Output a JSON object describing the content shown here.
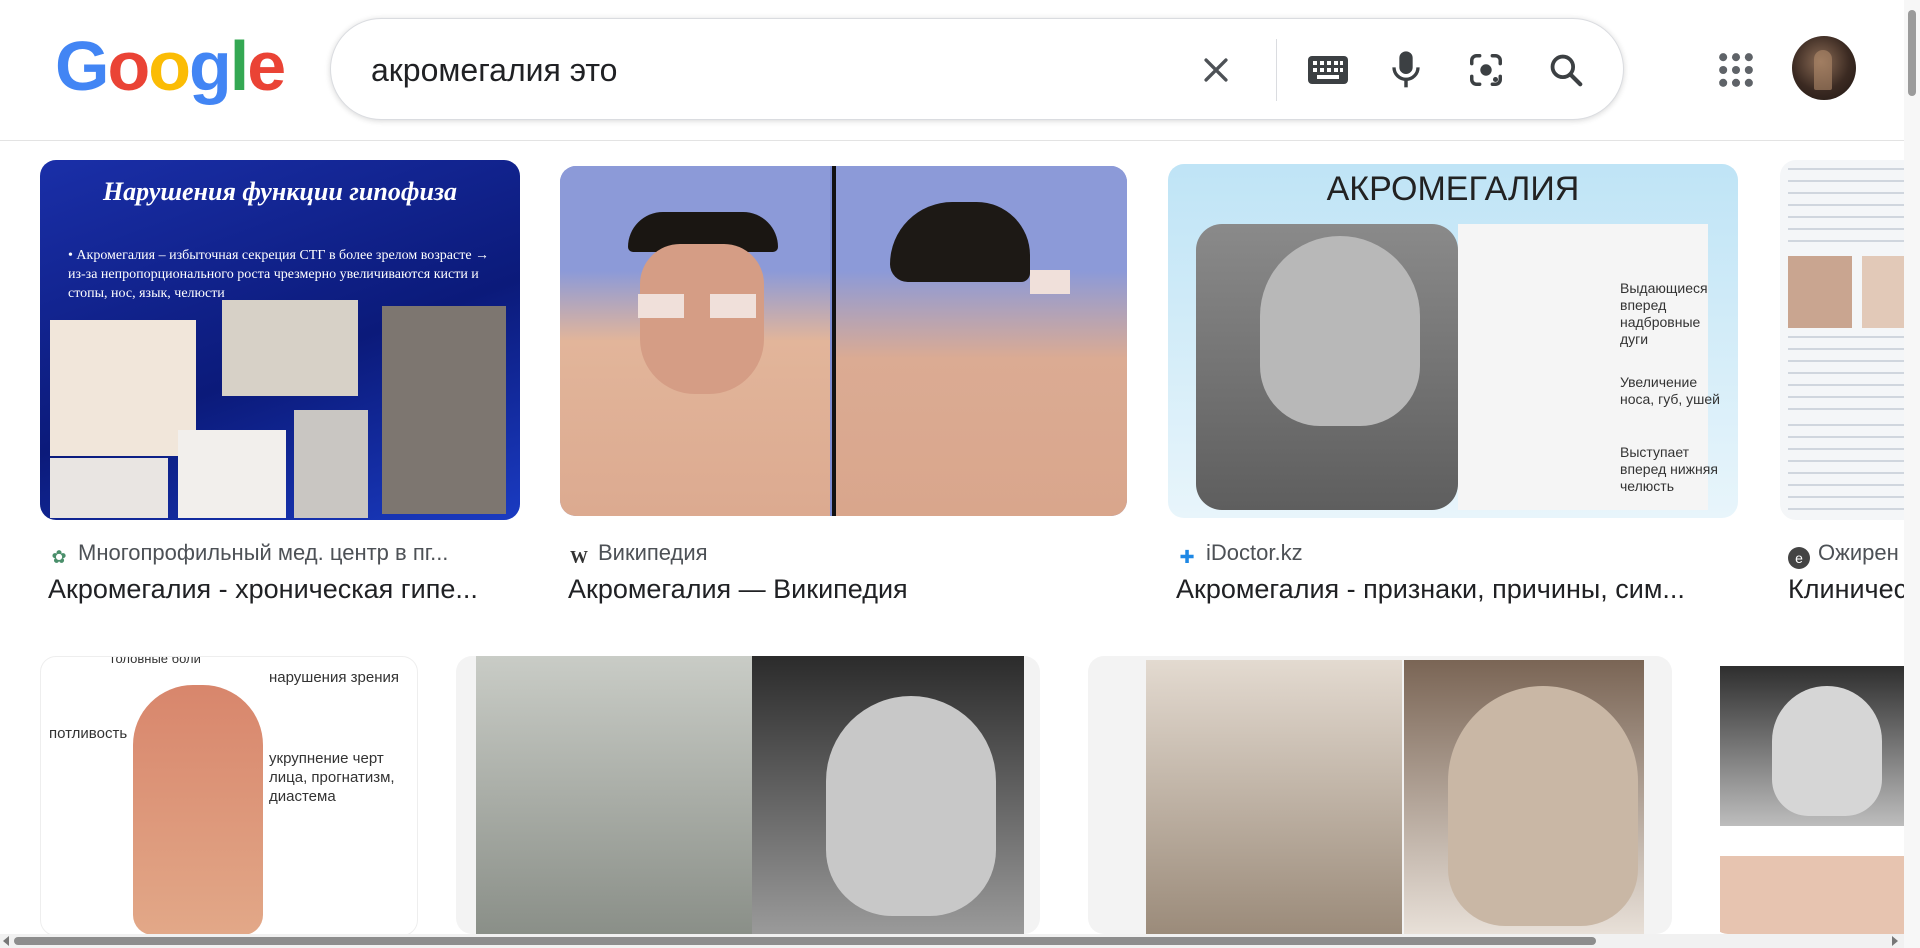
{
  "header": {
    "logo": "Google",
    "search_value": "акромегалия это",
    "icons": {
      "clear": "close-icon",
      "keyboard": "keyboard-icon",
      "voice": "microphone-icon",
      "lens": "camera-lens-icon",
      "search": "search-icon",
      "apps": "apps-grid-icon"
    }
  },
  "results_row1": [
    {
      "source": "Многопрофильный мед. центр в пг...",
      "title": "Акромегалия - хроническая гипе...",
      "image_text": {
        "heading": "Нарушения функции гипофиза",
        "body": "• Акромегалия – избыточная секреция СТГ в более зрелом возрасте → из-за непропорционального роста чрезмерно увеличиваются кисти и стопы, нос, язык, челюсти"
      }
    },
    {
      "source": "Википедия",
      "title": "Акромегалия — Википедия"
    },
    {
      "source": "iDoctor.kz",
      "title": "Акромегалия - признаки, причины, сим...",
      "image_text": {
        "heading": "АКРОМЕГАЛИЯ",
        "labels": [
          "Выдающиеся вперед надбровные дуги",
          "Увеличение носа, губ, ушей",
          "Выступает вперед нижняя челюсть"
        ]
      }
    },
    {
      "source": "Ожирен",
      "title": "Клиничес"
    }
  ],
  "results_row2": [
    {
      "image_text": {
        "labels": [
          "головные боли",
          "нарушения зрения",
          "потливость",
          "укрупнение черт лица, прогнатизм, диастема"
        ]
      }
    },
    {},
    {},
    {}
  ],
  "colors": {
    "google_blue": "#4285F4",
    "google_red": "#EA4335",
    "google_yellow": "#FBBC05",
    "google_green": "#34A853"
  }
}
